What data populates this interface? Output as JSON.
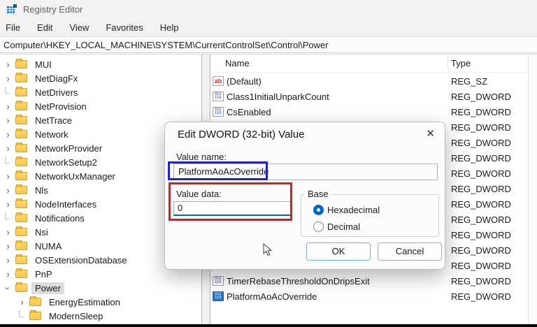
{
  "window": {
    "title": "Registry Editor"
  },
  "menu": {
    "items": [
      "File",
      "Edit",
      "View",
      "Favorites",
      "Help"
    ]
  },
  "address": "Computer\\HKEY_LOCAL_MACHINE\\SYSTEM\\CurrentControlSet\\Control\\Power",
  "tree": {
    "items": [
      {
        "label": "MUI",
        "state": "collapsed",
        "level": 0,
        "selected": false
      },
      {
        "label": "NetDiagFx",
        "state": "collapsed",
        "level": 0,
        "selected": false
      },
      {
        "label": "NetDrivers",
        "state": "leaf",
        "level": 0,
        "selected": false
      },
      {
        "label": "NetProvision",
        "state": "collapsed",
        "level": 0,
        "selected": false
      },
      {
        "label": "NetTrace",
        "state": "collapsed",
        "level": 0,
        "selected": false
      },
      {
        "label": "Network",
        "state": "collapsed",
        "level": 0,
        "selected": false
      },
      {
        "label": "NetworkProvider",
        "state": "collapsed",
        "level": 0,
        "selected": false
      },
      {
        "label": "NetworkSetup2",
        "state": "leaf",
        "level": 0,
        "selected": false
      },
      {
        "label": "NetworkUxManager",
        "state": "collapsed",
        "level": 0,
        "selected": false
      },
      {
        "label": "Nls",
        "state": "collapsed",
        "level": 0,
        "selected": false
      },
      {
        "label": "NodeInterfaces",
        "state": "collapsed",
        "level": 0,
        "selected": false
      },
      {
        "label": "Notifications",
        "state": "leaf",
        "level": 0,
        "selected": false
      },
      {
        "label": "Nsi",
        "state": "collapsed",
        "level": 0,
        "selected": false
      },
      {
        "label": "NUMA",
        "state": "collapsed",
        "level": 0,
        "selected": false
      },
      {
        "label": "OSExtensionDatabase",
        "state": "collapsed",
        "level": 0,
        "selected": false
      },
      {
        "label": "PnP",
        "state": "collapsed",
        "level": 0,
        "selected": false
      },
      {
        "label": "Power",
        "state": "expanded",
        "level": 0,
        "selected": true
      },
      {
        "label": "EnergyEstimation",
        "state": "collapsed",
        "level": 1,
        "selected": false
      },
      {
        "label": "ModernSleep",
        "state": "leaf",
        "level": 1,
        "selected": false
      }
    ]
  },
  "list": {
    "columns": [
      "Name",
      "Type"
    ],
    "rows": [
      {
        "name": "(Default)",
        "icon": "string",
        "type": "REG_SZ",
        "selected": false
      },
      {
        "name": "Class1InitialUnparkCount",
        "icon": "dword",
        "type": "REG_DWORD",
        "selected": false
      },
      {
        "name": "CsEnabled",
        "icon": "dword",
        "type": "REG_DWORD",
        "selected": false
      },
      {
        "name": "",
        "icon": "none",
        "type": "REG_DWORD",
        "selected": false
      },
      {
        "name": "",
        "icon": "none",
        "type": "REG_DWORD",
        "selected": false
      },
      {
        "name": "",
        "icon": "none",
        "type": "REG_DWORD",
        "selected": false
      },
      {
        "name": "",
        "icon": "none",
        "type": "REG_DWORD",
        "selected": false
      },
      {
        "name": "",
        "icon": "none",
        "type": "REG_DWORD",
        "selected": false
      },
      {
        "name": "",
        "icon": "none",
        "type": "REG_DWORD",
        "selected": false
      },
      {
        "name": "",
        "icon": "none",
        "type": "REG_DWORD",
        "selected": false
      },
      {
        "name": "",
        "icon": "none",
        "type": "REG_DWORD",
        "selected": false
      },
      {
        "name": "",
        "icon": "none",
        "type": "REG_DWORD",
        "selected": false
      },
      {
        "name": "",
        "icon": "none",
        "type": "REG_DWORD",
        "selected": false
      },
      {
        "name": "TimerRebaseThresholdOnDripsExit",
        "icon": "dword",
        "type": "REG_DWORD",
        "selected": false
      },
      {
        "name": "PlatformAoAcOverride",
        "icon": "dword",
        "type": "REG_DWORD",
        "selected": true
      }
    ]
  },
  "dialog": {
    "title": "Edit DWORD (32-bit) Value",
    "close_glyph": "✕",
    "value_name_label": "Value name:",
    "value_name": "PlatformAoAcOverride",
    "value_data_label": "Value data:",
    "value_data": "0",
    "base_label": "Base",
    "radio_hexadecimal": "Hexadecimal",
    "radio_decimal": "Decimal",
    "ok_label": "OK",
    "cancel_label": "Cancel"
  },
  "colors": {
    "accent_blue": "#0067c0",
    "annotation_blue": "#2121d1",
    "annotation_red": "#e41717",
    "folder_yellow": "#f7c64e",
    "selection_gray": "#dcdcdc"
  }
}
